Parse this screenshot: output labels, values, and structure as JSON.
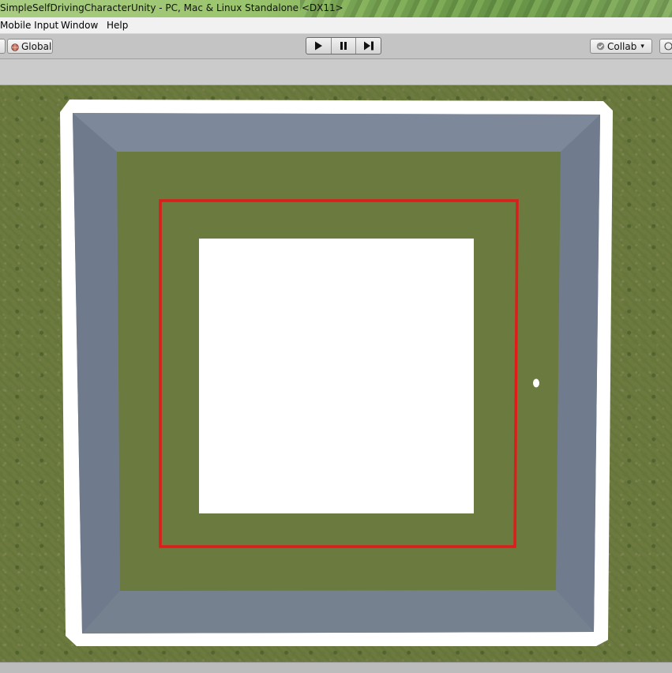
{
  "window": {
    "title": "SimpleSelfDrivingCharacterUnity - PC, Mac & Linux Standalone <DX11>"
  },
  "menu": {
    "items": [
      "Mobile Input",
      "Window",
      "Help"
    ]
  },
  "toolbar": {
    "pivot_mode_label": "Global",
    "collab_label": "Collab",
    "collab_arrow": "▾"
  },
  "play_controls": {
    "play_icon": "play-icon",
    "pause_icon": "pause-icon",
    "step_icon": "step-icon"
  },
  "colors": {
    "grass": "#6b7a3e",
    "wall": "#7a8597",
    "barrier": "#ffffff",
    "path_line": "#e21a1a",
    "inner_block": "#ffffff"
  }
}
